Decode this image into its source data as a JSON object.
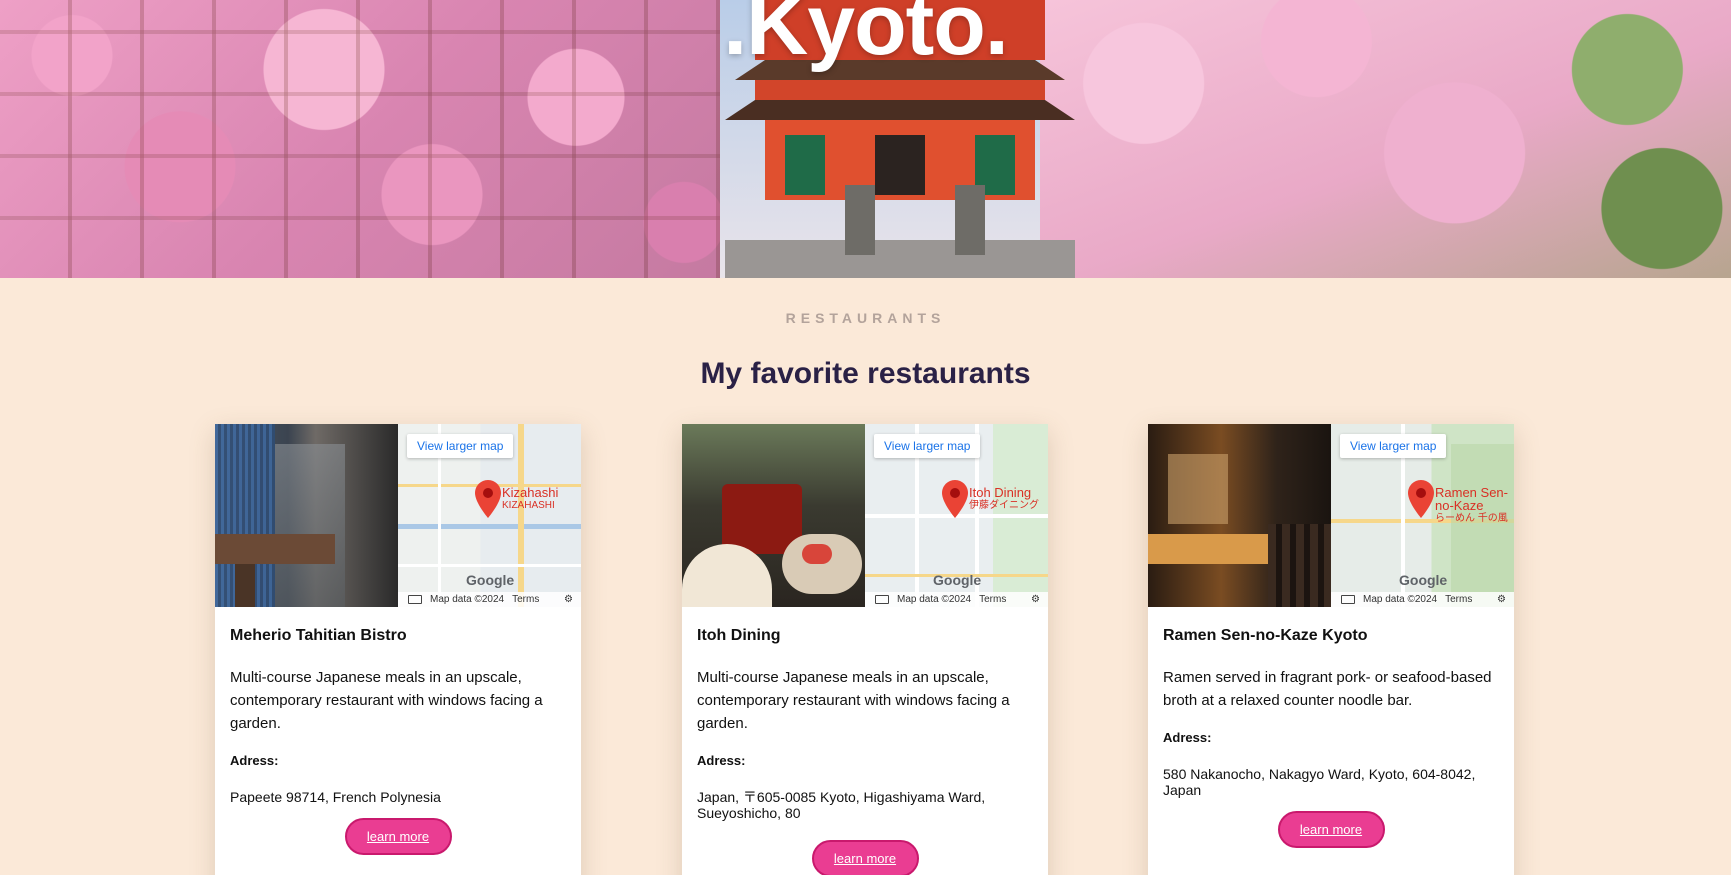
{
  "hero": {
    "title": ".Kyoto."
  },
  "section": {
    "eyebrow": "RESTAURANTS",
    "title": "My favorite restaurants"
  },
  "colors": {
    "background": "#fbe9d8",
    "title": "#2a2146",
    "eyebrow": "#b3a39b",
    "button": "#ea3d92",
    "button_border": "#c9196d",
    "map_link": "#1a73e8",
    "map_pin": "#d93025"
  },
  "cards": [
    {
      "map": {
        "view_larger": "View larger map",
        "pin_label": "Kizahashi",
        "pin_label_sub": "KIZAHASHI",
        "map_data": "Map data ©2024",
        "terms": "Terms",
        "logo": "Google"
      },
      "name": "Meherio Tahitian Bistro",
      "description": "Multi-course Japanese meals in an upscale, contemporary restaurant with windows facing a garden.",
      "address_label": "Adress:",
      "address": "Papeete 98714, French Polynesia",
      "button": "learn more"
    },
    {
      "map": {
        "view_larger": "View larger map",
        "pin_label": "Itoh Dining",
        "pin_label_sub": "伊藤ダイニング",
        "map_data": "Map data ©2024",
        "terms": "Terms",
        "logo": "Google"
      },
      "name": "Itoh Dining",
      "description": "Multi-course Japanese meals in an upscale, contemporary restaurant with windows facing a garden.",
      "address_label": "Adress:",
      "address": "Japan, 〒605-0085 Kyoto, Higashiyama Ward, Sueyoshicho, 80",
      "button": "learn more"
    },
    {
      "map": {
        "view_larger": "View larger map",
        "pin_label": "Ramen Sen-no-Kaze",
        "pin_label_sub": "らーめん 千の風",
        "map_data": "Map data ©2024",
        "terms": "Terms",
        "logo": "Google"
      },
      "name": "Ramen Sen-no-Kaze Kyoto",
      "description": "Ramen served in fragrant pork- or seafood-based broth at a relaxed counter noodle bar.",
      "address_label": "Adress:",
      "address": "580 Nakanocho, Nakagyo Ward, Kyoto, 604-8042, Japan",
      "button": "learn more"
    }
  ]
}
